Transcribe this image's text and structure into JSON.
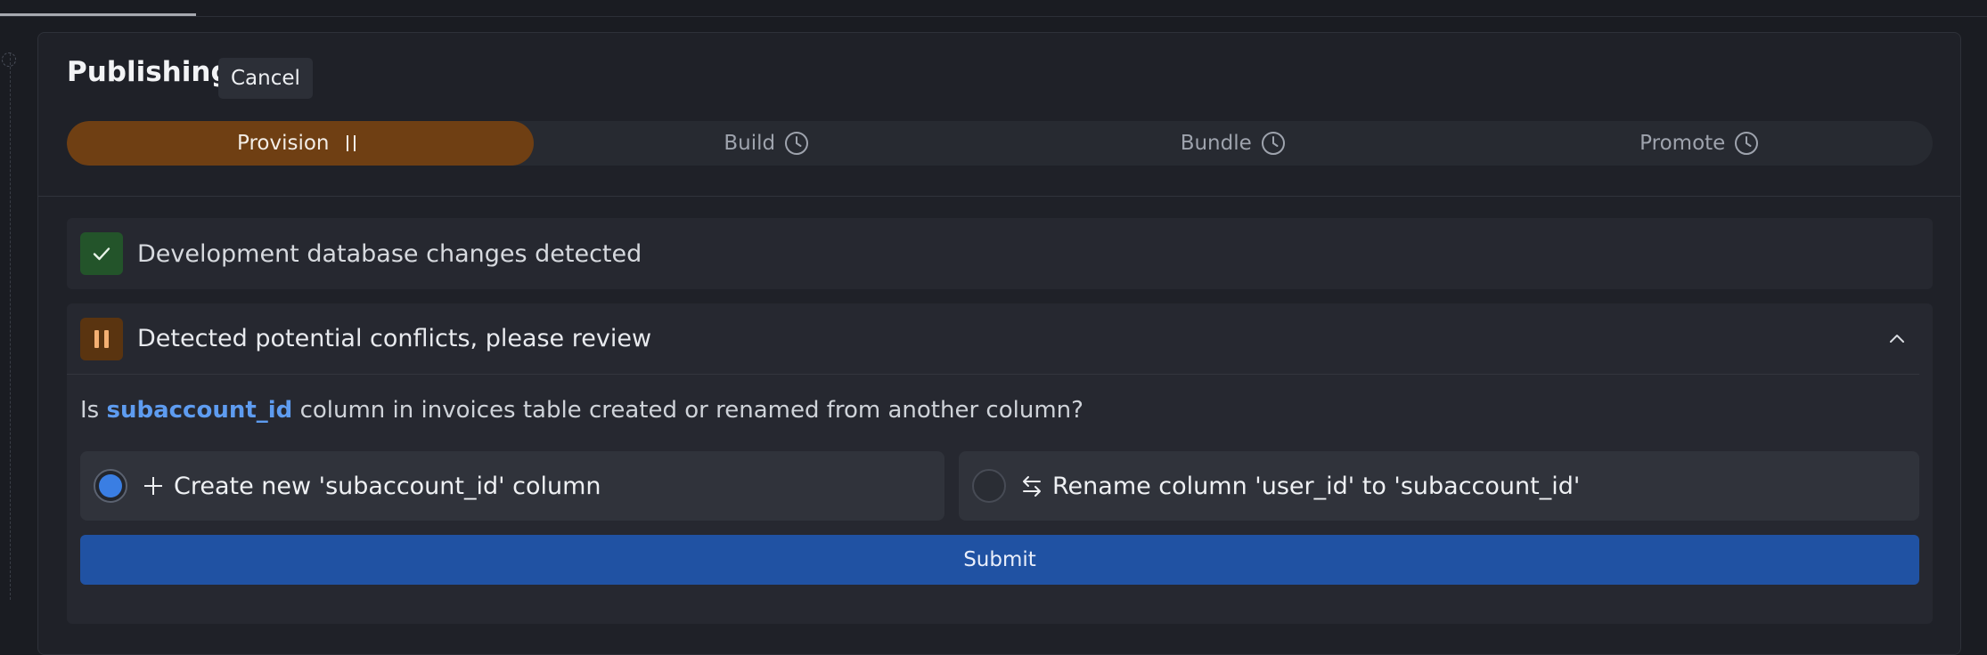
{
  "header": {
    "title": "Publishing",
    "cancel_label": "Cancel"
  },
  "steps": [
    {
      "label": "Provision",
      "icon": "pause-icon",
      "state": "active"
    },
    {
      "label": "Build",
      "icon": "clock-icon",
      "state": "pending"
    },
    {
      "label": "Bundle",
      "icon": "clock-icon",
      "state": "pending"
    },
    {
      "label": "Promote",
      "icon": "clock-icon",
      "state": "pending"
    }
  ],
  "checks": {
    "db_changes": {
      "text": "Development database changes detected",
      "status": "success",
      "icon": "check-icon"
    },
    "conflicts": {
      "text": "Detected potential conflicts, please review",
      "status": "paused",
      "icon": "pause-icon"
    }
  },
  "conflict": {
    "question_prefix": "Is",
    "column_name": "subaccount_id",
    "question_suffix": "column in invoices table created or renamed from another column?",
    "options": [
      {
        "label": "Create new 'subaccount_id' column",
        "icon": "plus-icon",
        "selected": true
      },
      {
        "label": "Rename column 'user_id' to 'subaccount_id'",
        "icon": "swap-arrows-icon",
        "selected": false
      }
    ],
    "submit_label": "Submit"
  },
  "colors": {
    "active_step": "#6f3f13",
    "success": "#23542a",
    "warning": "#5a3410",
    "accent": "#3a7ee3",
    "link": "#5e9cf0",
    "submit": "#2052a3"
  }
}
